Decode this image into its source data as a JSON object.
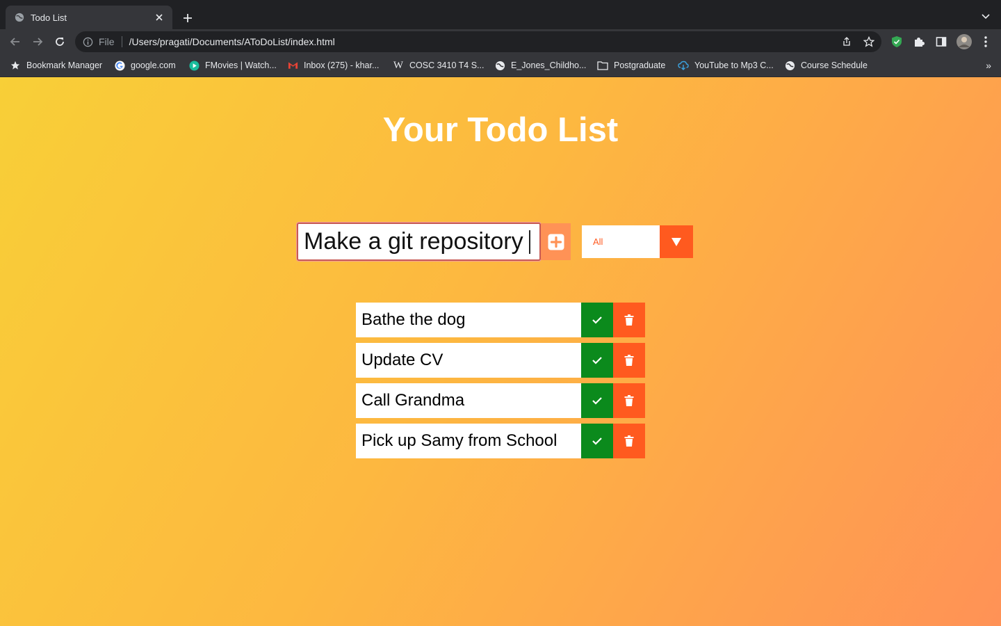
{
  "browser": {
    "tab_title": "Todo List",
    "scheme_label": "File",
    "url": "/Users/pragati/Documents/AToDoList/index.html",
    "bookmarks": [
      {
        "label": "Bookmark Manager",
        "icon": "star-icon"
      },
      {
        "label": "google.com",
        "icon": "google-icon"
      },
      {
        "label": "FMovies | Watch...",
        "icon": "fmovies-icon"
      },
      {
        "label": "Inbox (275) - khar...",
        "icon": "gmail-icon"
      },
      {
        "label": "COSC 3410 T4 S...",
        "icon": "wikipedia-icon"
      },
      {
        "label": "E_Jones_Childho...",
        "icon": "globe-icon"
      },
      {
        "label": "Postgraduate",
        "icon": "folder-icon"
      },
      {
        "label": "YouTube to Mp3 C...",
        "icon": "download-cloud-icon"
      },
      {
        "label": "Course Schedule",
        "icon": "globe-icon"
      }
    ],
    "more_bookmarks": "»"
  },
  "app": {
    "title": "Your Todo List",
    "input_value": "Make a git repository",
    "filter_selected": "All",
    "todos": [
      {
        "text": "Bathe the dog"
      },
      {
        "text": "Update CV"
      },
      {
        "text": "Call Grandma"
      },
      {
        "text": "Pick up Samy from School"
      }
    ]
  },
  "colors": {
    "gradient_start": "#f8cf37",
    "gradient_end": "#ff9256",
    "complete_green": "#0b8a1c",
    "delete_orange": "#ff5a1f",
    "add_button": "#ff9256"
  }
}
